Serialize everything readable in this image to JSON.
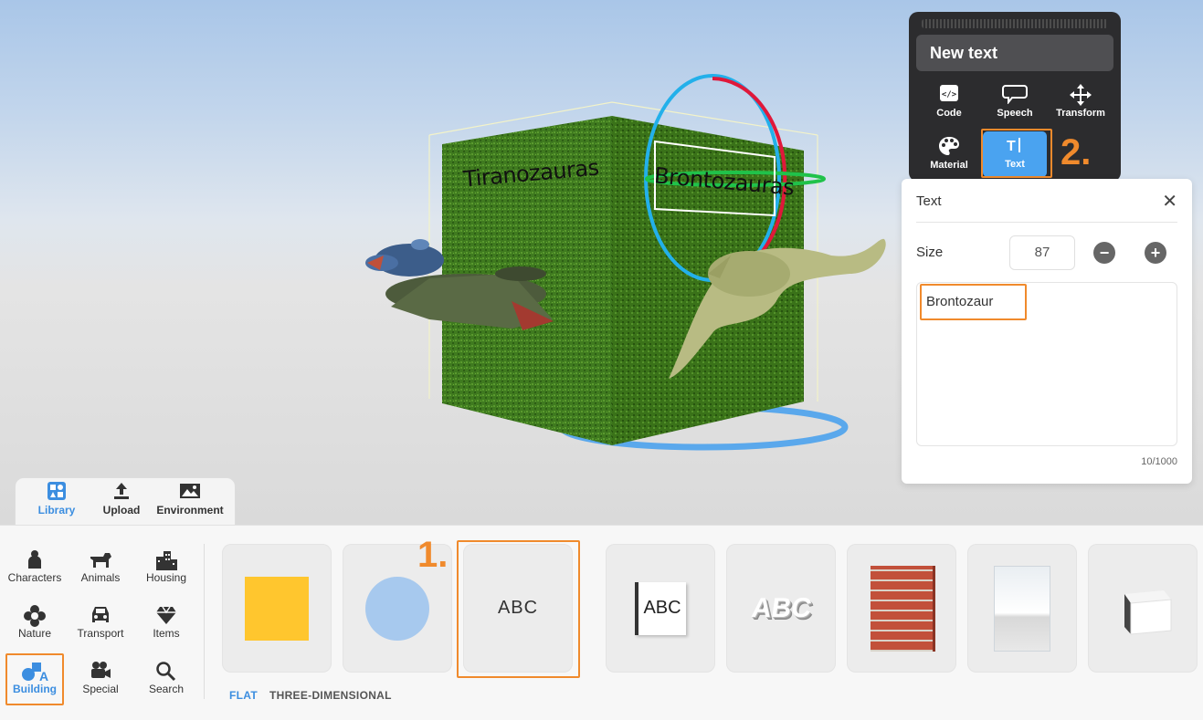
{
  "scene": {
    "cube_labels": [
      "Tiranozauras",
      "Brontozauras"
    ]
  },
  "object_panel": {
    "title": "New text",
    "tools": [
      {
        "label": "Code",
        "icon": "code-icon"
      },
      {
        "label": "Speech",
        "icon": "speech-icon"
      },
      {
        "label": "Transform",
        "icon": "transform-icon"
      },
      {
        "label": "Material",
        "icon": "palette-icon"
      },
      {
        "label": "Text",
        "icon": "text-cursor-icon",
        "active": true
      }
    ]
  },
  "text_panel": {
    "title": "Text",
    "size_label": "Size",
    "size_value": "87",
    "text_value": "Brontozaur",
    "char_count": "10/1000"
  },
  "annotations": {
    "step1": "1.",
    "step2": "2."
  },
  "library_tabs": [
    {
      "label": "Library",
      "icon": "library-icon",
      "active": true
    },
    {
      "label": "Upload",
      "icon": "upload-icon"
    },
    {
      "label": "Environment",
      "icon": "environment-icon"
    }
  ],
  "categories": [
    {
      "label": "Characters",
      "icon": "person-icon"
    },
    {
      "label": "Animals",
      "icon": "dog-icon"
    },
    {
      "label": "Housing",
      "icon": "buildings-icon"
    },
    {
      "label": "Nature",
      "icon": "flower-icon"
    },
    {
      "label": "Transport",
      "icon": "car-icon"
    },
    {
      "label": "Items",
      "icon": "diamond-icon"
    },
    {
      "label": "Building",
      "icon": "shapes-icon",
      "active": true
    },
    {
      "label": "Special",
      "icon": "camera-icon"
    },
    {
      "label": "Search",
      "icon": "search-icon"
    }
  ],
  "cards": [
    {
      "name": "yellow-square",
      "color": "#FFC62E"
    },
    {
      "name": "blue-circle",
      "color": "#A7C9EE"
    },
    {
      "name": "flat-text",
      "text": "ABC"
    },
    {
      "name": "sign-text",
      "text": "ABC"
    },
    {
      "name": "3d-text",
      "text": "ABC"
    },
    {
      "name": "brick-wall"
    },
    {
      "name": "glass-panel"
    },
    {
      "name": "white-cube"
    }
  ],
  "filters": [
    {
      "label": "FLAT",
      "active": true
    },
    {
      "label": "THREE-DIMENSIONAL"
    }
  ],
  "colors": {
    "accent": "#3C8EE0",
    "annotation": "#F08A2C",
    "panel_dark": "#2C2C2E",
    "tool_active": "#4AA3F0"
  }
}
